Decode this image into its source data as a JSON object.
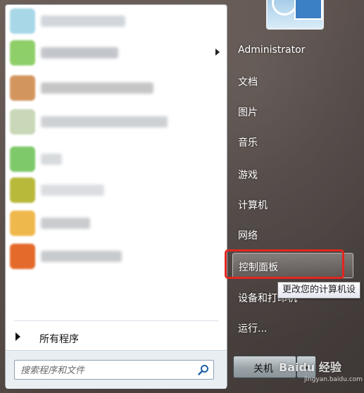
{
  "window": {
    "title": "Start Menu"
  },
  "programs": [
    {
      "icon_color": "#a8d8e8",
      "label_color": "#c9cfd6",
      "label_width": 120,
      "has_submenu": false
    },
    {
      "icon_color": "#8fcf6a",
      "label_color": "#b8bcc2",
      "label_width": 110,
      "has_submenu": true
    },
    {
      "icon_color": "#d3955e",
      "label_color": "#bcbcbc",
      "label_width": 160,
      "has_submenu": false
    },
    {
      "icon_color": "#c9d8b8",
      "label_color": "#c6c9cc",
      "label_width": 180,
      "has_submenu": false
    },
    {
      "icon_color": "#7ec96a",
      "label_color": "#d0d4d8",
      "label_width": 30,
      "has_submenu": false
    },
    {
      "icon_color": "#b8b83a",
      "label_color": "#d5d8dc",
      "label_width": 90,
      "has_submenu": false
    },
    {
      "icon_color": "#efb84c",
      "label_color": "#c0c3c7",
      "label_width": 70,
      "has_submenu": false
    },
    {
      "icon_color": "#e36a2a",
      "label_color": "#bfc2c6",
      "label_width": 115,
      "has_submenu": false
    }
  ],
  "all_programs_label": "所有程序",
  "search": {
    "placeholder": "搜索程序和文件"
  },
  "right_items": {
    "user": "Administrator",
    "documents": "文档",
    "pictures": "图片",
    "music": "音乐",
    "games": "游戏",
    "computer": "计算机",
    "network": "网络",
    "control_panel": "控制面板",
    "devices": "设备和打印机",
    "run": "运行..."
  },
  "tooltip": "更改您的计算机设",
  "shutdown_label": "关机",
  "watermark": {
    "brand": "Baidu 经验",
    "url": "jingyan.baidu.com"
  },
  "colors": {
    "highlight_border": "#e3261e",
    "right_text": "#ffffff"
  },
  "icons": {
    "search": "search-icon",
    "user_picture": "user-picture-icon"
  }
}
